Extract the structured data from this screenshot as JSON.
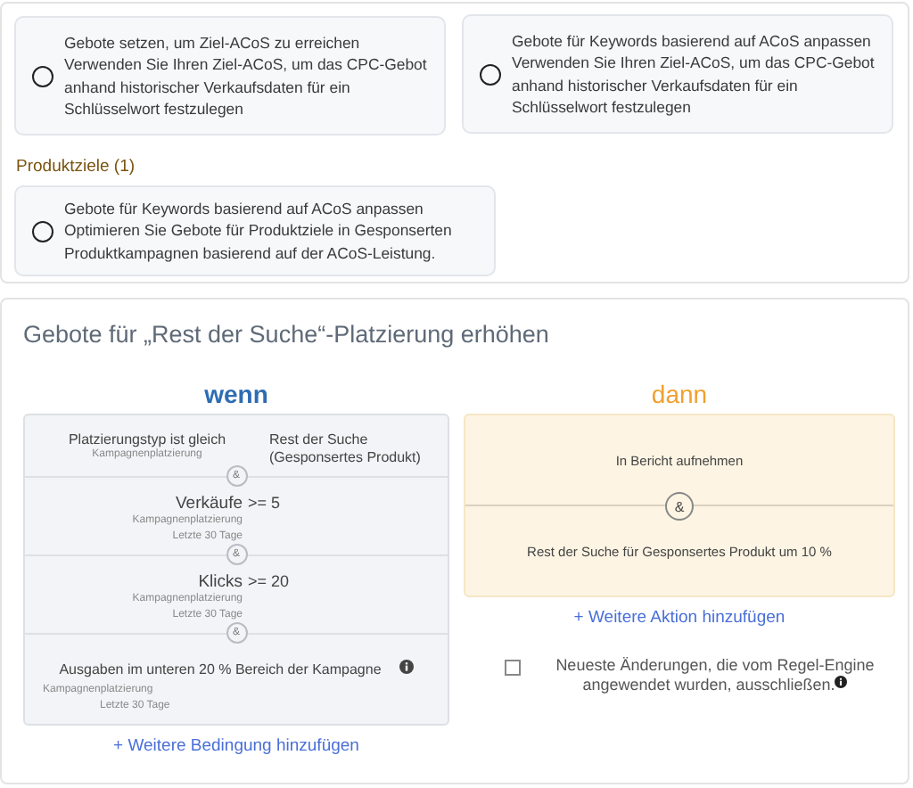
{
  "options_top": [
    {
      "title": "Gebote setzen, um Ziel-ACoS zu erreichen",
      "description": "Verwenden Sie Ihren Ziel-ACoS, um das CPC-Gebot anhand historischer Verkaufsdaten für ein Schlüsselwort festzulegen",
      "selected": false
    },
    {
      "title": "Gebote für Keywords basierend auf ACoS anpassen",
      "description": "Verwenden Sie Ihren Ziel-ACoS, um das CPC-Gebot anhand historischer Verkaufsdaten für ein Schlüsselwort festzulegen",
      "selected": false
    }
  ],
  "product_targets": {
    "heading": "Produktziele (1)",
    "options": [
      {
        "title": "Gebote für Keywords basierend auf ACoS anpassen",
        "description": "Optimieren Sie Gebote für Produktziele in Gesponserten Produktkampagnen basierend auf der ACoS-Leistung.",
        "selected": false
      }
    ]
  },
  "rule": {
    "title": "Gebote für „Rest der Suche“-Platzierung erhöhen",
    "if": {
      "heading": "wenn",
      "conditions": [
        {
          "kind": "columns",
          "label": "Platzierungstyp ist gleich",
          "meta": [
            "Kampagnenplatzierung"
          ],
          "value": "Rest der Suche (Gesponsertes Produkt)"
        },
        {
          "kind": "inline",
          "joiner": "&",
          "label": "Verkäufe",
          "meta": [
            "Kampagnenplatzierung",
            "Letzte 30 Tage"
          ],
          "value": ">= 5"
        },
        {
          "kind": "inline",
          "joiner": "&",
          "label": "Klicks",
          "meta": [
            "Kampagnenplatzierung",
            "Letzte 30 Tage"
          ],
          "value": ">= 20"
        },
        {
          "kind": "info",
          "joiner": "&",
          "label": "Ausgaben im unteren 20 % Bereich der Kampagne",
          "meta": [
            "Kampagnenplatzierung",
            "Letzte 30 Tage"
          ]
        }
      ],
      "add_link": "+ Weitere Bedingung hinzufügen"
    },
    "then": {
      "heading": "dann",
      "actions": [
        {
          "label": "In Bericht aufnehmen"
        },
        {
          "joiner": "&",
          "label": "Rest der Suche für Gesponsertes Produkt um 10 %"
        }
      ],
      "add_link": "+ Weitere Aktion hinzufügen"
    },
    "exclude": {
      "label": "Neueste Änderungen, die vom Regel-Engine angewendet wurden, ausschließen.",
      "checked": false
    }
  }
}
